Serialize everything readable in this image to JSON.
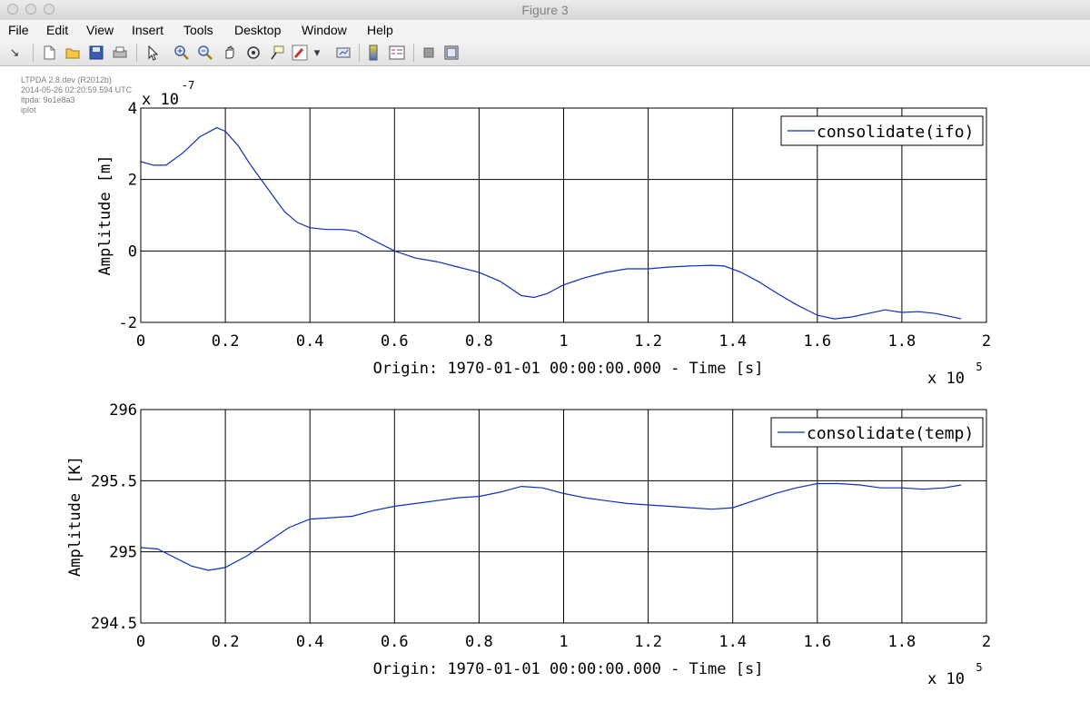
{
  "window": {
    "title": "Figure 3"
  },
  "menubar": {
    "items": [
      "File",
      "Edit",
      "View",
      "Insert",
      "Tools",
      "Desktop",
      "Window",
      "Help"
    ]
  },
  "toolbar": {
    "icons": [
      "dock-arrow-icon",
      "new-figure-icon",
      "open-file-icon",
      "save-icon",
      "print-icon",
      "select-arrow-icon",
      "zoom-in-icon",
      "zoom-out-icon",
      "pan-hand-icon",
      "rotate-3d-icon",
      "data-cursor-icon",
      "brush-icon",
      "brush-dropdown-icon",
      "link-plot-icon",
      "colorbar-icon",
      "legend-icon",
      "hide-plot-tools-icon",
      "show-plot-tools-icon"
    ]
  },
  "metadata": {
    "lines": [
      "LTPDA 2.8.dev (R2012b)",
      "2014-05-26 02:20:59.594 UTC",
      "ltpda: 9o1e8a3",
      "iplot"
    ]
  },
  "chart_data": [
    {
      "type": "line",
      "title": "",
      "xlabel": "Origin: 1970-01-01 00:00:00.000 - Time  [s]",
      "ylabel": "Amplitude  [m]",
      "x_exponent_label": "x 10",
      "x_exponent": "5",
      "y_exponent_label": "x 10",
      "y_exponent": "-7",
      "xlim": [
        0,
        2
      ],
      "ylim": [
        -2,
        4
      ],
      "xticks": [
        "0",
        "0.2",
        "0.4",
        "0.6",
        "0.8",
        "1",
        "1.2",
        "1.4",
        "1.6",
        "1.8",
        "2"
      ],
      "yticks": [
        "-2",
        "0",
        "2",
        "4"
      ],
      "grid": true,
      "legend": "top-right",
      "series": [
        {
          "name": "consolidate(ifo)",
          "color": "#0b2fc0",
          "x": [
            0,
            0.03,
            0.06,
            0.1,
            0.14,
            0.18,
            0.2,
            0.23,
            0.26,
            0.3,
            0.34,
            0.37,
            0.4,
            0.44,
            0.48,
            0.51,
            0.55,
            0.6,
            0.65,
            0.7,
            0.75,
            0.8,
            0.85,
            0.9,
            0.93,
            0.96,
            1.0,
            1.05,
            1.1,
            1.15,
            1.2,
            1.25,
            1.3,
            1.35,
            1.38,
            1.42,
            1.46,
            1.5,
            1.55,
            1.6,
            1.64,
            1.68,
            1.72,
            1.76,
            1.8,
            1.84,
            1.88,
            1.92,
            1.94
          ],
          "y": [
            2.5,
            2.4,
            2.4,
            2.75,
            3.2,
            3.45,
            3.35,
            2.95,
            2.4,
            1.75,
            1.1,
            0.8,
            0.65,
            0.6,
            0.6,
            0.55,
            0.3,
            0.0,
            -0.2,
            -0.3,
            -0.45,
            -0.6,
            -0.85,
            -1.25,
            -1.3,
            -1.2,
            -0.95,
            -0.75,
            -0.6,
            -0.5,
            -0.5,
            -0.45,
            -0.42,
            -0.4,
            -0.42,
            -0.6,
            -0.85,
            -1.15,
            -1.5,
            -1.8,
            -1.9,
            -1.85,
            -1.75,
            -1.65,
            -1.72,
            -1.7,
            -1.75,
            -1.85,
            -1.9
          ]
        }
      ]
    },
    {
      "type": "line",
      "title": "",
      "xlabel": "Origin: 1970-01-01 00:00:00.000 - Time  [s]",
      "ylabel": "Amplitude  [K]",
      "x_exponent_label": "x 10",
      "x_exponent": "5",
      "xlim": [
        0,
        2
      ],
      "ylim": [
        294.5,
        296
      ],
      "xticks": [
        "0",
        "0.2",
        "0.4",
        "0.6",
        "0.8",
        "1",
        "1.2",
        "1.4",
        "1.6",
        "1.8",
        "2"
      ],
      "yticks": [
        "294.5",
        "295",
        "295.5",
        "296"
      ],
      "grid": true,
      "legend": "top-right",
      "series": [
        {
          "name": "consolidate(temp)",
          "color": "#0b2fc0",
          "x": [
            0,
            0.04,
            0.08,
            0.12,
            0.16,
            0.2,
            0.25,
            0.3,
            0.35,
            0.4,
            0.45,
            0.5,
            0.55,
            0.6,
            0.65,
            0.7,
            0.75,
            0.8,
            0.85,
            0.9,
            0.95,
            1.0,
            1.05,
            1.1,
            1.15,
            1.2,
            1.25,
            1.3,
            1.35,
            1.4,
            1.45,
            1.5,
            1.55,
            1.6,
            1.65,
            1.7,
            1.75,
            1.8,
            1.85,
            1.9,
            1.94
          ],
          "y": [
            295.03,
            295.02,
            294.96,
            294.9,
            294.87,
            294.89,
            294.97,
            295.07,
            295.17,
            295.23,
            295.24,
            295.25,
            295.29,
            295.32,
            295.34,
            295.36,
            295.38,
            295.39,
            295.42,
            295.46,
            295.45,
            295.41,
            295.38,
            295.36,
            295.34,
            295.33,
            295.32,
            295.31,
            295.3,
            295.31,
            295.36,
            295.41,
            295.45,
            295.48,
            295.48,
            295.47,
            295.45,
            295.45,
            295.44,
            295.45,
            295.47
          ]
        }
      ]
    }
  ]
}
